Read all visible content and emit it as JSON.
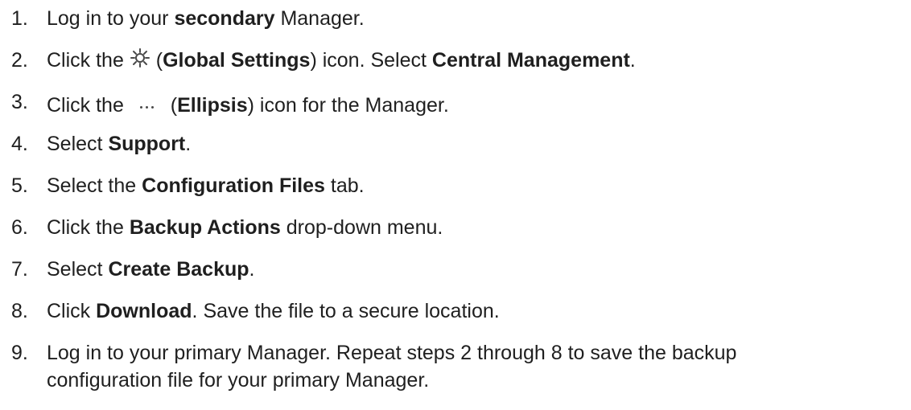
{
  "steps": [
    {
      "num": "1.",
      "pre": "Log in to your ",
      "bold": "secondary",
      "post": " Manager."
    },
    {
      "num": "2.",
      "pre": "Click the ",
      "icon_name": "gear-icon",
      "after_icon": " (",
      "bold": "Global Settings",
      "mid": ") icon. Select ",
      "bold2": "Central Management",
      "post": "."
    },
    {
      "num": "3.",
      "pre": "Click the ",
      "icon_name": "ellipsis-icon",
      "after_icon": " (",
      "bold": "Ellipsis",
      "post": ") icon for the Manager."
    },
    {
      "num": "4.",
      "pre": "Select ",
      "bold": "Support",
      "post": "."
    },
    {
      "num": "5.",
      "pre": "Select the ",
      "bold": "Configuration Files",
      "post": " tab."
    },
    {
      "num": "6.",
      "pre": "Click the ",
      "bold": "Backup Actions",
      "post": " drop-down menu."
    },
    {
      "num": "7.",
      "pre": "Select ",
      "bold": "Create Backup",
      "post": "."
    },
    {
      "num": "8.",
      "pre": "Click ",
      "bold": "Download",
      "post": ". Save the file to a secure location."
    },
    {
      "num": "9.",
      "line1": "Log in to your primary Manager. Repeat steps 2 through 8 to save the backup",
      "line2": "configuration file for your primary Manager."
    }
  ],
  "colors": {
    "text": "#1f1f1f",
    "icon": "#4a4a4a"
  }
}
